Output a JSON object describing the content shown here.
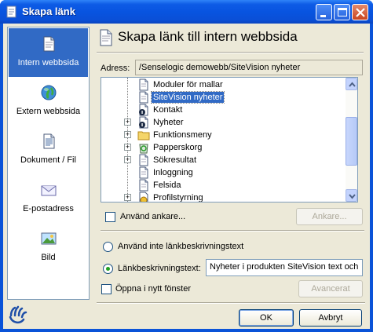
{
  "window": {
    "title": "Skapa länk"
  },
  "sidebar": {
    "items": [
      {
        "label": "Intern webbsida",
        "icon": "page-icon",
        "selected": true
      },
      {
        "label": "Extern webbsida",
        "icon": "globe-icon",
        "selected": false
      },
      {
        "label": "Dokument / Fil",
        "icon": "document-icon",
        "selected": false
      },
      {
        "label": "E-postadress",
        "icon": "envelope-icon",
        "selected": false
      },
      {
        "label": "Bild",
        "icon": "image-icon",
        "selected": false
      }
    ]
  },
  "header": {
    "title": "Skapa länk till intern webbsida"
  },
  "address": {
    "label": "Adress:",
    "value": "/Senselogic demowebb/SiteVision nyheter"
  },
  "tree": {
    "items": [
      {
        "label": "Moduler för mallar",
        "icon": "page-icon",
        "expandable": false,
        "selected": false
      },
      {
        "label": "SiteVision nyheter",
        "icon": "page-icon",
        "expandable": false,
        "selected": true
      },
      {
        "label": "Kontakt",
        "icon": "page-info-icon",
        "expandable": false,
        "selected": false
      },
      {
        "label": "Nyheter",
        "icon": "page-info-icon",
        "expandable": true,
        "selected": false
      },
      {
        "label": "Funktionsmeny",
        "icon": "folder-icon",
        "expandable": true,
        "selected": false
      },
      {
        "label": "Papperskorg",
        "icon": "recycle-icon",
        "expandable": true,
        "selected": false
      },
      {
        "label": "Sökresultat",
        "icon": "page-icon",
        "expandable": true,
        "selected": false
      },
      {
        "label": "Inloggning",
        "icon": "page-icon",
        "expandable": false,
        "selected": false
      },
      {
        "label": "Felsida",
        "icon": "page-icon",
        "expandable": false,
        "selected": false
      },
      {
        "label": "Profilstyrning",
        "icon": "profile-icon",
        "expandable": true,
        "selected": false
      }
    ]
  },
  "anchor": {
    "checkbox_label": "Använd ankare...",
    "checked": false,
    "button_label": "Ankare..."
  },
  "link_text": {
    "option_none_label": "Använd inte länkbeskrivningstext",
    "option_custom_label": "Länkbeskrivningstext:",
    "selected_option": "custom",
    "value": "Nyheter i produkten SiteVision text och"
  },
  "new_window": {
    "checkbox_label": "Öppna i nytt fönster",
    "checked": false
  },
  "buttons": {
    "advanced": "Avancerat",
    "ok": "OK",
    "cancel": "Avbryt"
  },
  "colors": {
    "titlebar": "#0a53d8",
    "selection": "#316ac5",
    "dialog_bg": "#ece9d8"
  }
}
